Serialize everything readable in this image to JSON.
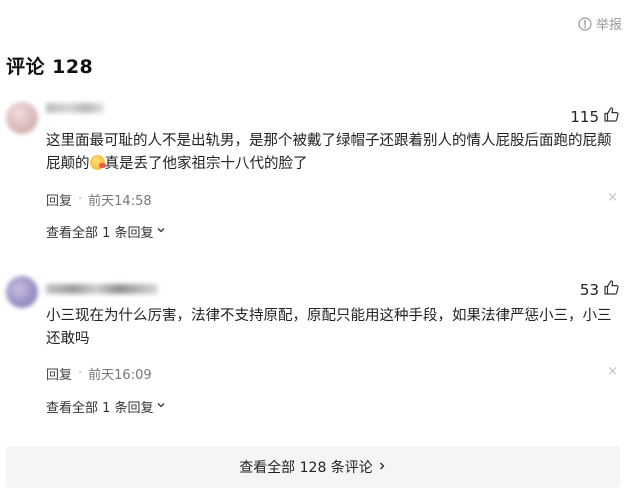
{
  "header": {
    "report_label": "举报",
    "title": "评论 128"
  },
  "comments": [
    {
      "likes": "115",
      "text_part1": "这里面最可耻的人不是出轨男，是那个被戴了绿帽子还跟着别人的情人屁股后面跑的屁颠屁颠的",
      "text_part2": "真是丢了他家祖宗十八代的脸了",
      "reply_label": "回复",
      "time": "前天14:58",
      "close_symbol": "×",
      "replies_link": "查看全部 1 条回复"
    },
    {
      "likes": "53",
      "text_part1": "小三现在为什么厉害，法律不支持原配，原配只能用这种手段，如果法律严惩小三，小三还敢吗",
      "reply_label": "回复",
      "time": "前天16:09",
      "close_symbol": "×",
      "replies_link": "查看全部 1 条回复"
    }
  ],
  "footer": {
    "view_all_label": "查看全部 128 条评论"
  },
  "icons": {
    "report": "warning-circle-icon",
    "like": "thumbs-up-icon",
    "close": "close-icon",
    "chevron_down": "chevron-down-icon",
    "chevron_right": "chevron-right-icon"
  }
}
